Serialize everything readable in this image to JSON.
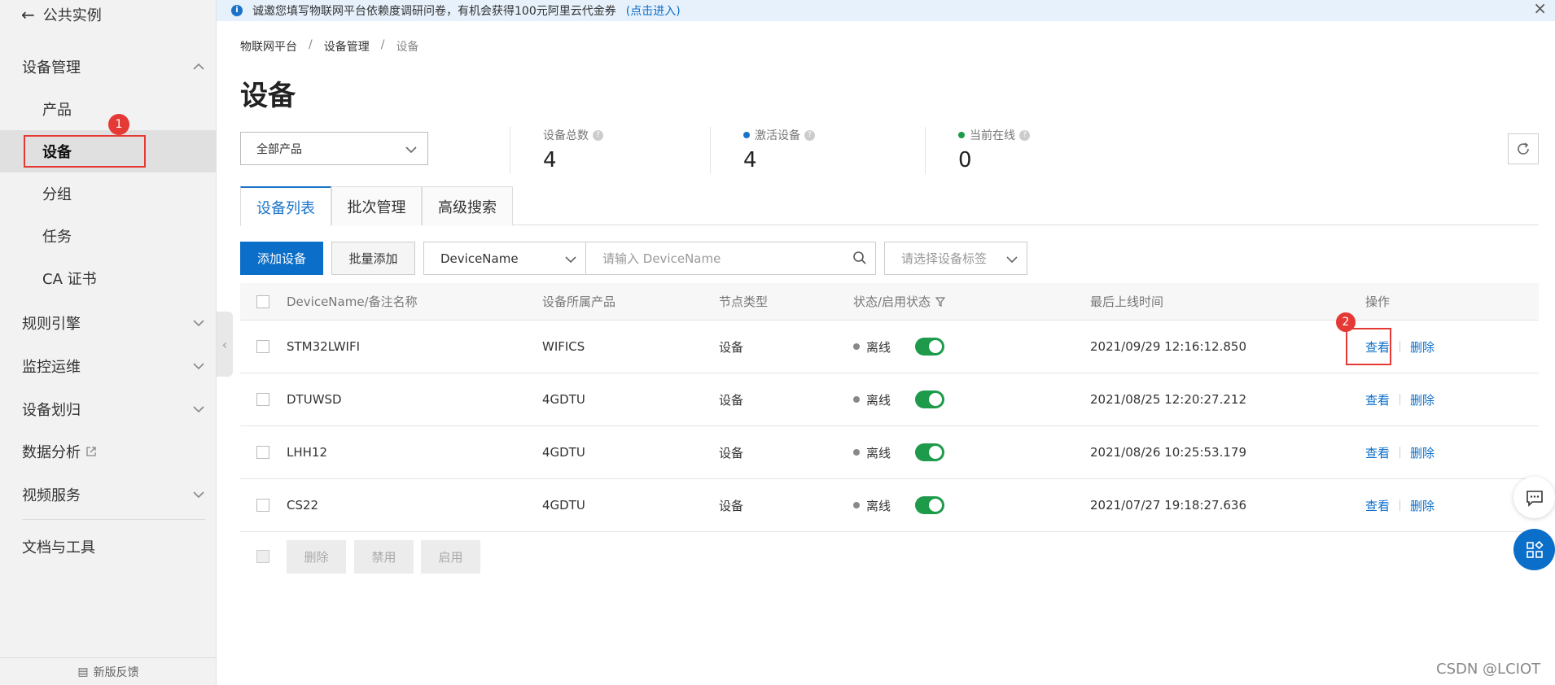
{
  "sidebar": {
    "back_label": "公共实例",
    "groups": [
      {
        "label": "设备管理",
        "expanded": true
      },
      {
        "label": "规则引擎",
        "expanded": false
      },
      {
        "label": "监控运维",
        "expanded": false
      },
      {
        "label": "设备划归",
        "expanded": false
      },
      {
        "label": "数据分析",
        "external": true
      },
      {
        "label": "视频服务",
        "expanded": false
      },
      {
        "label": "文档与工具"
      }
    ],
    "sub_items": [
      {
        "label": "产品"
      },
      {
        "label": "设备",
        "active": true
      },
      {
        "label": "分组"
      },
      {
        "label": "任务"
      },
      {
        "label": "CA 证书"
      }
    ],
    "feedback_label": "新版反馈"
  },
  "annotations": {
    "marker_1": "1",
    "marker_2": "2"
  },
  "banner": {
    "text": "诚邀您填写物联网平台依赖度调研问卷，有机会获得100元阿里云代金券",
    "link": "(点击进入)"
  },
  "breadcrumb": [
    "物联网平台",
    "设备管理",
    "设备"
  ],
  "page_title": "设备",
  "product_select": {
    "value": "全部产品"
  },
  "stats": [
    {
      "label": "设备总数",
      "value": "4",
      "dot_color": null
    },
    {
      "label": "激活设备",
      "value": "4",
      "dot_color": "#1a73c9"
    },
    {
      "label": "当前在线",
      "value": "0",
      "dot_color": "#1e9a4b"
    }
  ],
  "tabs": [
    {
      "label": "设备列表",
      "active": true
    },
    {
      "label": "批次管理",
      "active": false
    },
    {
      "label": "高级搜索",
      "active": false
    }
  ],
  "toolbar": {
    "add_button": "添加设备",
    "batch_add_button": "批量添加",
    "field_select": "DeviceName",
    "search_placeholder": "请输入 DeviceName",
    "tag_placeholder": "请选择设备标签"
  },
  "table": {
    "headers": [
      "DeviceName/备注名称",
      "设备所属产品",
      "节点类型",
      "状态/启用状态",
      "最后上线时间",
      "操作"
    ],
    "rows": [
      {
        "name": "STM32LWIFI",
        "product": "WIFICS",
        "node_type": "设备",
        "status": "离线",
        "enabled": true,
        "last_online": "2021/09/29 12:16:12.850",
        "view": "查看",
        "delete": "删除"
      },
      {
        "name": "DTUWSD",
        "product": "4GDTU",
        "node_type": "设备",
        "status": "离线",
        "enabled": true,
        "last_online": "2021/08/25 12:20:27.212",
        "view": "查看",
        "delete": "删除"
      },
      {
        "name": "LHH12",
        "product": "4GDTU",
        "node_type": "设备",
        "status": "离线",
        "enabled": true,
        "last_online": "2021/08/26 10:25:53.179",
        "view": "查看",
        "delete": "删除"
      },
      {
        "name": "CS22",
        "product": "4GDTU",
        "node_type": "设备",
        "status": "离线",
        "enabled": true,
        "last_online": "2021/07/27 19:18:27.636",
        "view": "查看",
        "delete": "删除"
      }
    ]
  },
  "footer_actions": [
    "删除",
    "禁用",
    "启用"
  ],
  "watermark": "CSDN @LCIOT",
  "colors": {
    "accent": "#0b6ec9",
    "toggle_on": "#1e9a4b",
    "annotation_red": "#e53935"
  }
}
